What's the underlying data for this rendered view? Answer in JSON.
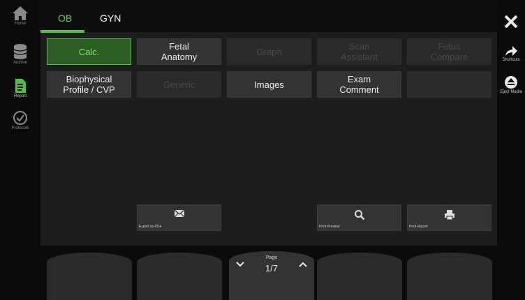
{
  "left_nav": [
    {
      "label": "Home",
      "icon": "home-icon"
    },
    {
      "label": "Archive",
      "icon": "database-icon"
    },
    {
      "label": "Report",
      "icon": "report-icon"
    },
    {
      "label": "Protocols",
      "icon": "check-circle-icon"
    }
  ],
  "tabs": [
    {
      "label": "OB"
    },
    {
      "label": "GYN"
    }
  ],
  "buttons": [
    {
      "label": "Calc.",
      "state": "selected"
    },
    {
      "label": "Fetal\nAnatomy",
      "state": "enabled"
    },
    {
      "label": "Graph",
      "state": "disabled"
    },
    {
      "label": "Scan\nAssistant",
      "state": "disabled"
    },
    {
      "label": "Fetus\nCompare",
      "state": "disabled"
    },
    {
      "label": "Biophysical\nProfile / CVP",
      "state": "enabled"
    },
    {
      "label": "Generic",
      "state": "disabled"
    },
    {
      "label": "Images",
      "state": "enabled"
    },
    {
      "label": "Exam\nComment",
      "state": "enabled"
    },
    {
      "label": "",
      "state": "empty"
    }
  ],
  "actions": {
    "export": {
      "label": "Export as PDF",
      "icon": "envelope-icon"
    },
    "preview": {
      "label": "Print Preview",
      "icon": "magnifier-icon"
    },
    "print": {
      "label": "Print Report",
      "icon": "printer-icon"
    }
  },
  "right_rail": {
    "close": {
      "icon": "close-icon"
    },
    "shortcuts": {
      "label": "Shortcuts",
      "icon": "arrow-right-icon"
    },
    "eject": {
      "label": "Eject Media",
      "icon": "eject-icon"
    }
  },
  "pager": {
    "caption": "Page",
    "value": "1/7"
  },
  "colors": {
    "accent": "#4cc53a",
    "selected_bg": "#2c5e24",
    "panel": "#1d1d1d"
  }
}
